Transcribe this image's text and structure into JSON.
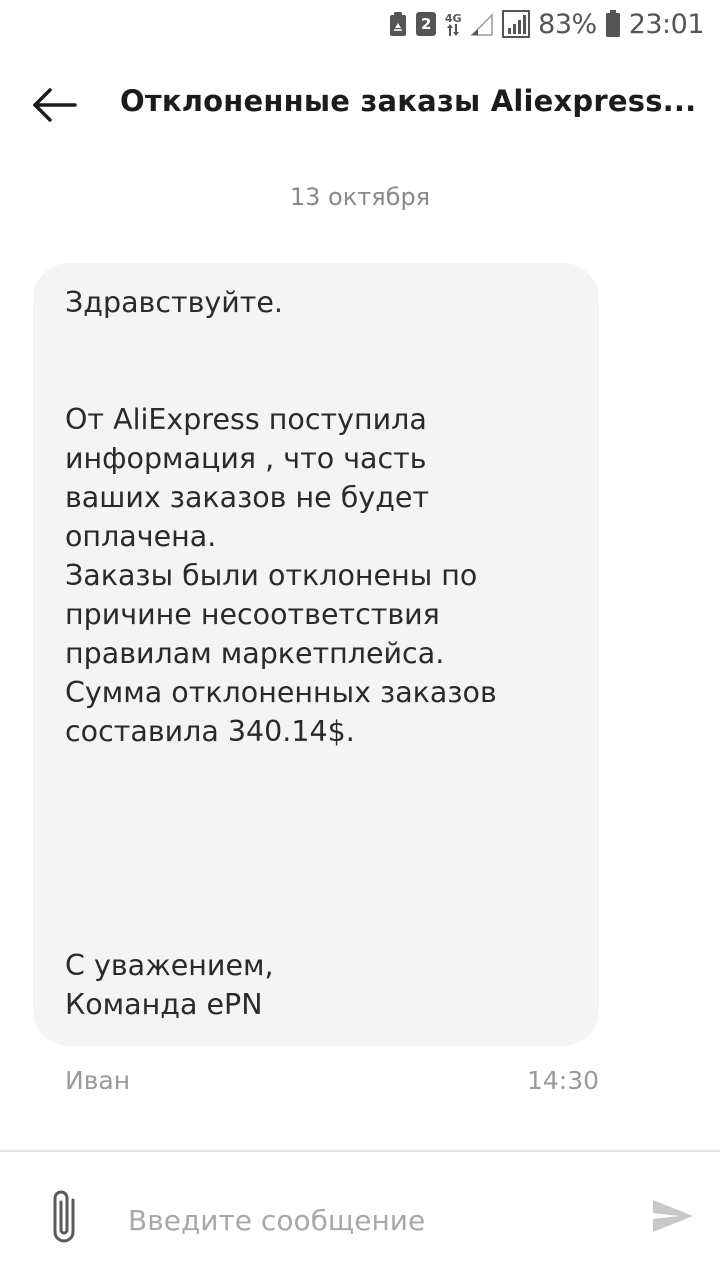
{
  "status_bar": {
    "sim_slot": "2",
    "network_type": "4G",
    "battery_percent": "83%",
    "time": "23:01"
  },
  "header": {
    "title": "Отклоненные заказы Aliexpress..."
  },
  "chat": {
    "date_label": "13 октября",
    "message": {
      "lines_greeting": [
        "Здравствуйте."
      ],
      "lines_body": [
        "От AliExpress поступила",
        "информация , что часть",
        "ваших заказов не будет",
        "оплачена.",
        "Заказы были отклонены по",
        "причине несоответствия",
        "правилам маркетплейса.",
        "Сумма отклоненных заказов",
        "составила 340.14$."
      ],
      "lines_signature": [
        "С уважением,",
        "Команда ePN"
      ],
      "sender": "Иван",
      "time": "14:30"
    }
  },
  "composer": {
    "placeholder": "Введите сообщение"
  },
  "colors": {
    "bubble_bg": "#f4f4f4",
    "muted_text": "#9a9a9a",
    "send_icon": "#c8c8c8"
  }
}
